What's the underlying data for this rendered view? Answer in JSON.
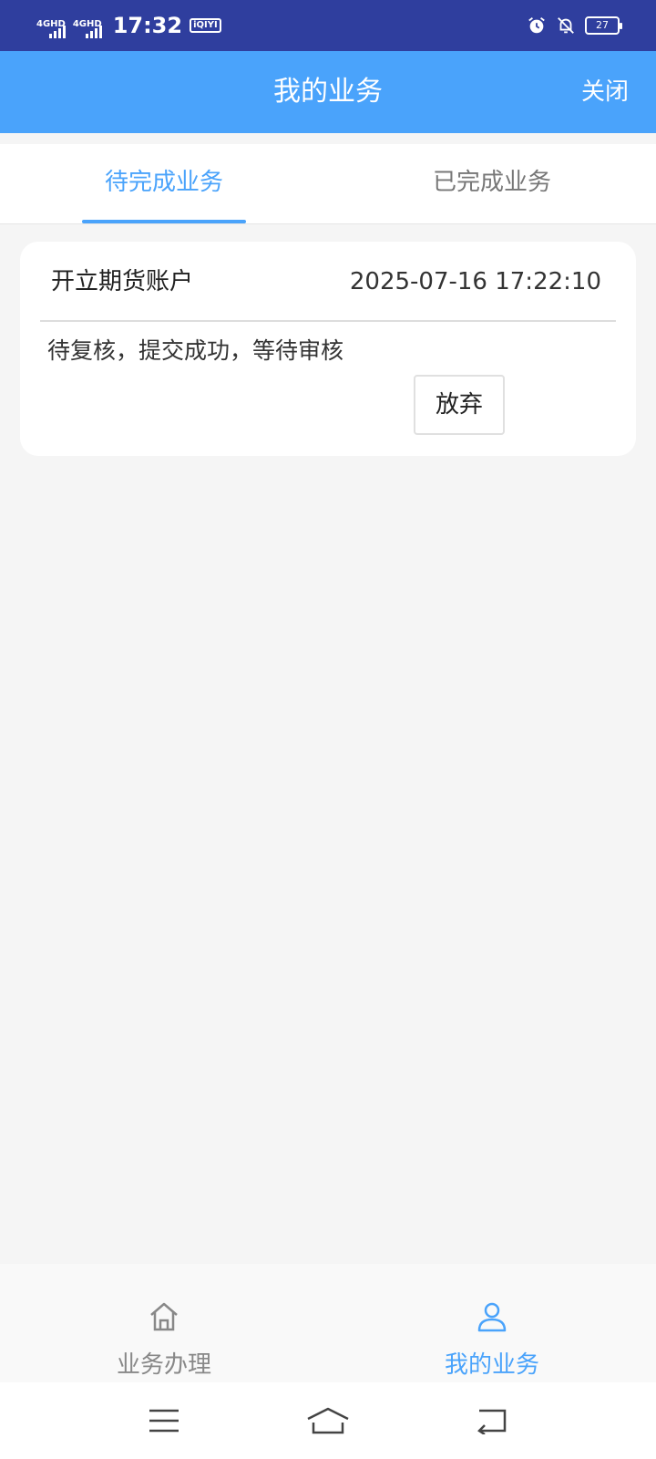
{
  "status_bar": {
    "signal1": "4GHD",
    "signal2": "4GHD",
    "time": "17:32",
    "app_badge": "iQIYI",
    "battery": "27"
  },
  "header": {
    "title": "我的业务",
    "close_label": "关闭"
  },
  "tabs": [
    {
      "label": "待完成业务",
      "active": true
    },
    {
      "label": "已完成业务",
      "active": false
    }
  ],
  "task_card": {
    "title": "开立期货账户",
    "timestamp": "2025-07-16 17:22:10",
    "status": "待复核，提交成功，等待审核",
    "abandon_label": "放弃"
  },
  "bottom_nav": [
    {
      "label": "业务办理",
      "icon": "home-icon",
      "active": false
    },
    {
      "label": "我的业务",
      "icon": "user-icon",
      "active": true
    }
  ],
  "colors": {
    "accent": "#4aa3fb",
    "status_bar": "#2f3e9e"
  }
}
